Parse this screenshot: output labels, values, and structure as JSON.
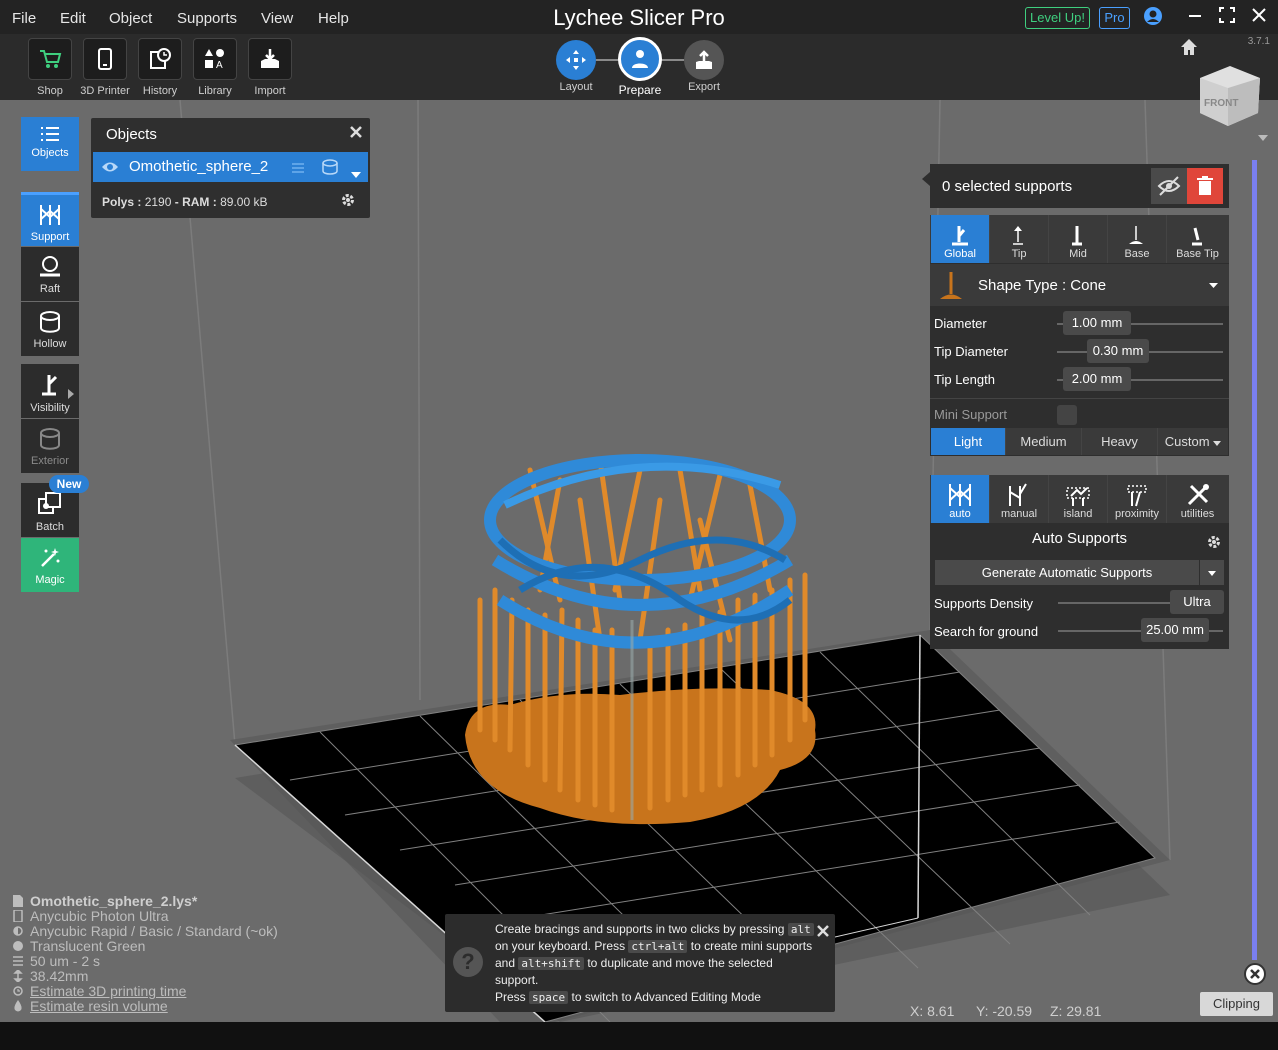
{
  "menu": {
    "items": [
      "File",
      "Edit",
      "Object",
      "Supports",
      "View",
      "Help"
    ],
    "title": "Lychee Slicer Pro",
    "level_up": "Level Up!",
    "pro": "Pro"
  },
  "toolbar": {
    "tools": [
      "Shop",
      "3D Printer",
      "History",
      "Library",
      "Import"
    ],
    "steps": [
      "Layout",
      "Prepare",
      "Export"
    ],
    "version": "3.7.1"
  },
  "sidebar": {
    "objects": "Objects",
    "support": "Support",
    "raft": "Raft",
    "hollow": "Hollow",
    "visibility": "Visibility",
    "exterior": "Exterior",
    "batch": "Batch",
    "new_badge": "New",
    "magic": "Magic"
  },
  "objects_panel": {
    "title": "Objects",
    "object_name": "Omothetic_sphere_2",
    "polys_label": "Polys :",
    "polys_value": "2190",
    "ram_label": "- RAM :",
    "ram_value": "89.00 kB"
  },
  "support_panel": {
    "selected": "0 selected supports",
    "tabs": [
      "Global",
      "Tip",
      "Mid",
      "Base",
      "Base Tip"
    ],
    "shape_type": "Shape Type : Cone",
    "diameter_label": "Diameter",
    "diameter_value": "1.00 mm",
    "tip_diameter_label": "Tip Diameter",
    "tip_diameter_value": "0.30 mm",
    "tip_length_label": "Tip Length",
    "tip_length_value": "2.00 mm",
    "mini_support": "Mini Support",
    "presets": [
      "Light",
      "Medium",
      "Heavy",
      "Custom"
    ]
  },
  "auto_panel": {
    "tabs": [
      "auto",
      "manual",
      "island",
      "proximity",
      "utilities"
    ],
    "title": "Auto Supports",
    "generate": "Generate Automatic Supports",
    "density_label": "Supports Density",
    "density_value": "Ultra",
    "ground_label": "Search for ground",
    "ground_value": "25.00 mm"
  },
  "info": {
    "file": "Omothetic_sphere_2.lys*",
    "printer": "Anycubic Photon Ultra",
    "resin": "Anycubic Rapid / Basic / Standard (~ok)",
    "color": "Translucent Green",
    "layer": "50 um - 2 s",
    "height": "38.42mm",
    "estimate_time": "Estimate 3D printing time",
    "estimate_resin": "Estimate resin volume"
  },
  "tip": {
    "line1a": "Create bracings and supports in two clicks by pressing",
    "k1": "alt",
    "line2a": "on your keyboard. Press",
    "k2": "ctrl+alt",
    "line2b": "to create mini supports",
    "line3a": "and",
    "k3": "alt+shift",
    "line3b": "to duplicate and move the selected",
    "line4": "support.",
    "line5a": "Press",
    "k4": "space",
    "line5b": "to switch to Advanced Editing Mode"
  },
  "coords": {
    "x": "X: 8.61",
    "y": "Y: -20.59",
    "z": "Z: 29.81"
  },
  "clipping": "Clipping"
}
